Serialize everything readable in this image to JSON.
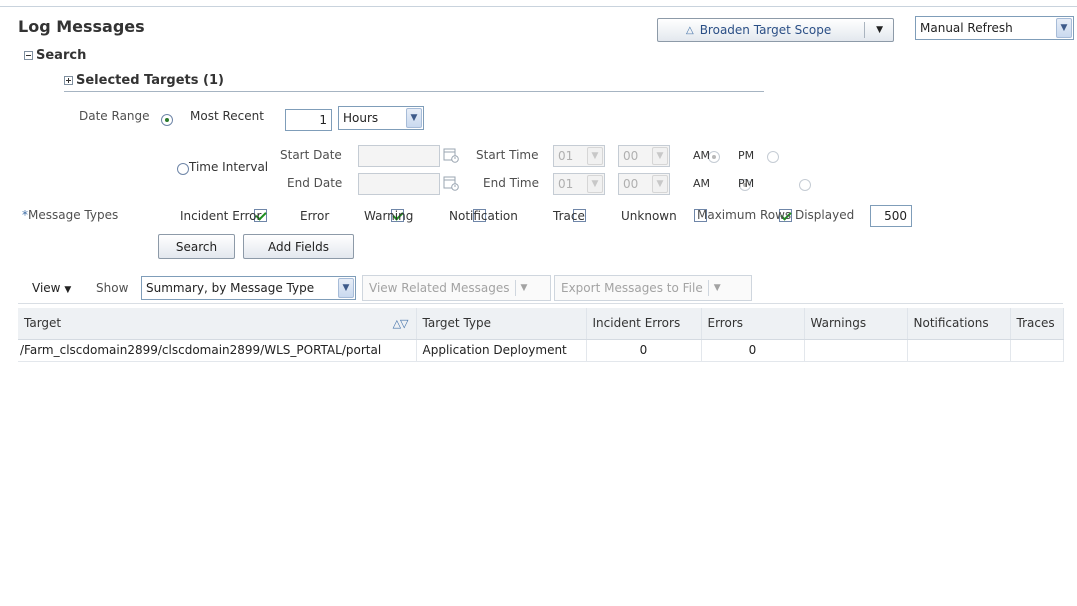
{
  "header": {
    "title": "Log Messages",
    "broaden_label": "Broaden Target Scope",
    "refresh_value": "Manual Refresh"
  },
  "search": {
    "section_label": "Search",
    "selected_targets_label": "Selected Targets (1)",
    "date_range_label": "Date Range",
    "most_recent_label": "Most Recent",
    "most_recent_value": "1",
    "unit_value": "Hours",
    "time_interval_label": "Time Interval",
    "start_date_label": "Start Date",
    "end_date_label": "End Date",
    "start_time_label": "Start Time",
    "end_time_label": "End Time",
    "start_hour": "01",
    "start_minute": "00",
    "end_hour": "01",
    "end_minute": "00",
    "am_label": "AM",
    "pm_label": "PM",
    "required_mark": "*",
    "message_types_label": "Message Types",
    "types": [
      {
        "label": "Incident Error",
        "checked": true
      },
      {
        "label": "Error",
        "checked": true
      },
      {
        "label": "Warning",
        "checked": false
      },
      {
        "label": "Notification",
        "checked": false
      },
      {
        "label": "Trace",
        "checked": false
      },
      {
        "label": "Unknown",
        "checked": true
      }
    ],
    "max_rows_label": "Maximum Rows Displayed",
    "max_rows_value": "500",
    "search_button": "Search",
    "add_fields_button": "Add Fields"
  },
  "toolbar": {
    "view_label": "View",
    "show_label": "Show",
    "show_value": "Summary, by Message Type",
    "related_label": "View Related Messages",
    "export_label": "Export Messages to File"
  },
  "table": {
    "columns": [
      "Target",
      "Target Type",
      "Incident Errors",
      "Errors",
      "Warnings",
      "Notifications",
      "Traces"
    ],
    "rows": [
      [
        "/Farm_clscdomain2899/clscdomain2899/WLS_PORTAL/portal",
        "Application Deployment",
        "0",
        "0",
        "",
        "",
        ""
      ]
    ]
  },
  "colors": {
    "accent_blue": "#3f6ea6",
    "check_green": "#1e8f1e",
    "header_bg": "#eef1f4"
  }
}
